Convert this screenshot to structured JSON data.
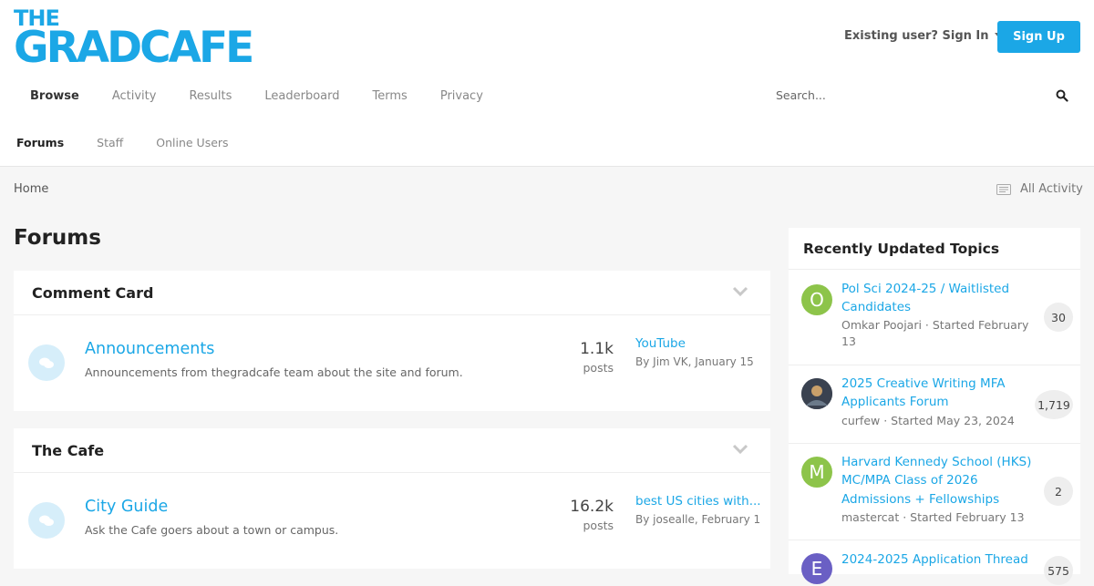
{
  "logo": {
    "line1": "THE",
    "line2": "GRADCAFE"
  },
  "header": {
    "signin_label": "Existing user? Sign In",
    "signup_label": "Sign Up"
  },
  "nav": {
    "items": [
      "Browse",
      "Activity",
      "Results",
      "Leaderboard",
      "Terms",
      "Privacy"
    ],
    "active": "Browse"
  },
  "search": {
    "placeholder": "Search..."
  },
  "subnav": {
    "items": [
      "Forums",
      "Staff",
      "Online Users"
    ],
    "active": "Forums"
  },
  "breadcrumb": {
    "home": "Home"
  },
  "all_activity": "All Activity",
  "page_title": "Forums",
  "sections": [
    {
      "title": "Comment Card",
      "forum": {
        "title": "Announcements",
        "description": "Announcements from thegradcafe team about the site and forum.",
        "count": "1.1k",
        "count_label": "posts",
        "last_title": "YouTube",
        "last_by": "By Jim VK, January 15"
      }
    },
    {
      "title": "The Cafe",
      "forum": {
        "title": "City Guide",
        "description": "Ask the Cafe goers about a town or campus.",
        "count": "16.2k",
        "count_label": "posts",
        "last_title": "best US cities with...",
        "last_by": "By josealle, February 1"
      }
    }
  ],
  "sidebar": {
    "title": "Recently Updated Topics",
    "topics": [
      {
        "avatar_letter": "O",
        "avatar_color": "#8dc44a",
        "title": "Pol Sci 2024-25 / Waitlisted Candidates",
        "meta": "Omkar Poojari · Started February 13",
        "count": "30"
      },
      {
        "avatar_letter": "",
        "avatar_color": "#3a4250",
        "title": "2025 Creative Writing MFA Applicants Forum",
        "meta": "curfew · Started May 23, 2024",
        "count": "1,719"
      },
      {
        "avatar_letter": "M",
        "avatar_color": "#8dc44a",
        "title": "Harvard Kennedy School (HKS) MC/MPA Class of 2026 Admissions + Fellowships",
        "meta": "mastercat · Started February 13",
        "count": "2"
      },
      {
        "avatar_letter": "E",
        "avatar_color": "#6a5fc4",
        "title": "2024-2025 Application Thread",
        "meta": "",
        "count": "575"
      }
    ]
  },
  "colors": {
    "accent": "#1ba7e6",
    "background": "#f6f6f6"
  }
}
